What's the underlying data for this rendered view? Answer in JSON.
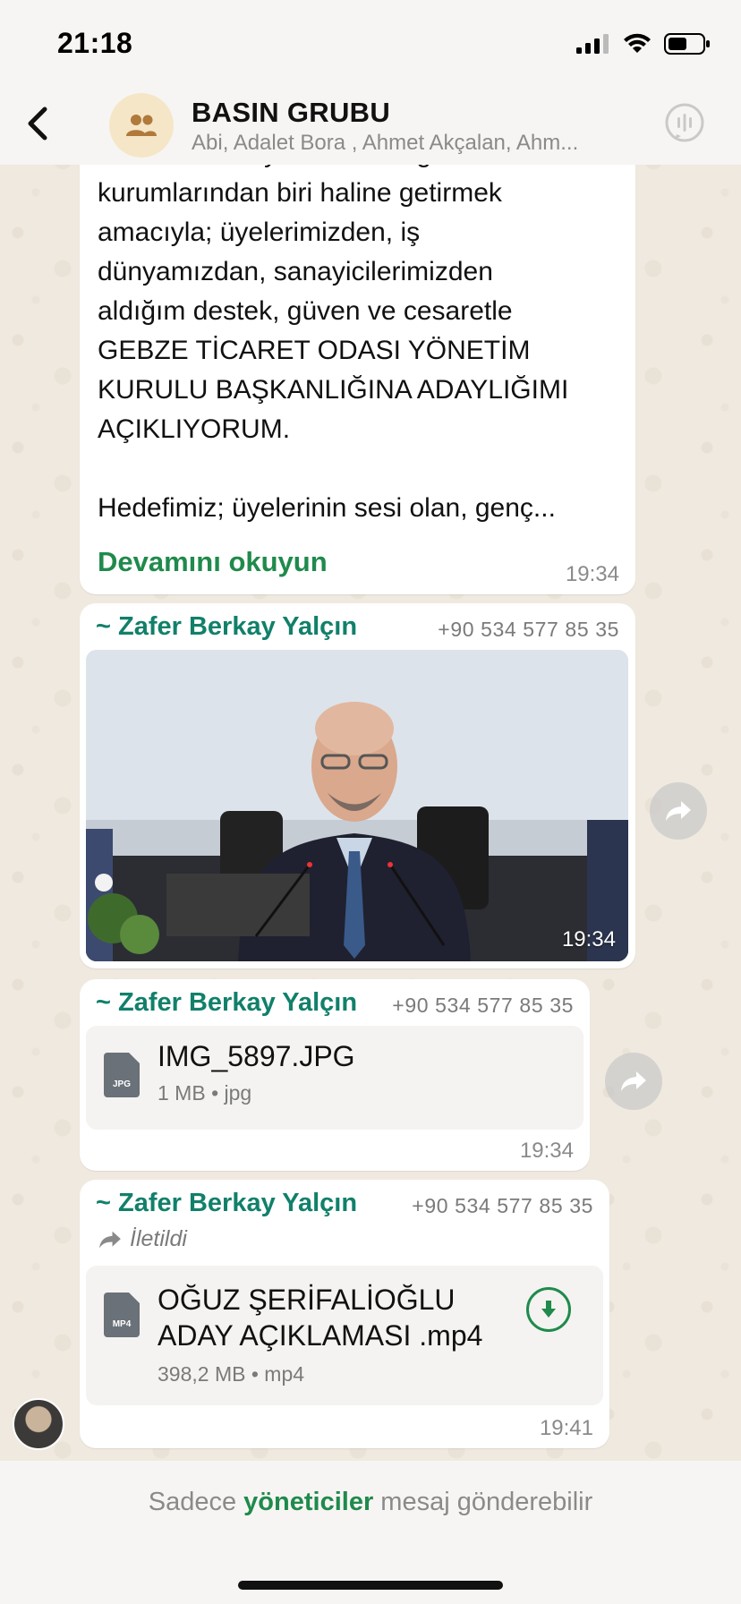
{
  "status_bar": {
    "time": "21:18"
  },
  "header": {
    "group_name": "BASIN GRUBU",
    "members": "Abi, Adalet Bora , Ahmet Akçalan, Ahm..."
  },
  "messages": [
    {
      "type": "text",
      "text": "Odası’nı Türkiye’nin örnek gösterilen\nkurumlarından biri haline getirmek\namacıyla; üyelerimizden, iş\ndünyamızdan, sanayicilerimizden\naldığım destek, güven ve cesaretle\nGEBZE TİCARET ODASI YÖNETİM\nKURULU BAŞKANLIĞINA ADAYLIĞIMI\nAÇIKLIYORUM.\n\nHedefimiz; üyelerinin sesi olan, genç...",
      "read_more": "Devamını okuyun",
      "time": "19:34"
    },
    {
      "type": "photo",
      "sender": "~ Zafer Berkay Yalçın",
      "phone": "+90 534 577 85 35",
      "time": "19:34"
    },
    {
      "type": "file",
      "sender": "~ Zafer Berkay Yalçın",
      "phone": "+90 534 577 85 35",
      "file_name": "IMG_5897.JPG",
      "file_meta": "1 MB • jpg",
      "file_badge": "JPG",
      "time": "19:34"
    },
    {
      "type": "file",
      "sender": "~ Zafer Berkay Yalçın",
      "phone": "+90 534 577 85 35",
      "forwarded_label": "İletildi",
      "file_name_line1": "OĞUZ ŞERİFALİOĞLU",
      "file_name_line2": "ADAY AÇIKLAMASI .mp4",
      "file_meta": "398,2 MB • mp4",
      "file_badge": "MP4",
      "time": "19:41"
    }
  ],
  "footer": {
    "prefix": "Sadece ",
    "link": "yöneticiler",
    "suffix": " mesaj gönderebilir"
  },
  "colors": {
    "accent": "#1f8a4c",
    "sender": "#11806a",
    "background": "#efeae2"
  },
  "icons": [
    "back-chevron-icon",
    "group-icon",
    "call-icon",
    "forward-icon",
    "download-icon",
    "file-icon"
  ]
}
